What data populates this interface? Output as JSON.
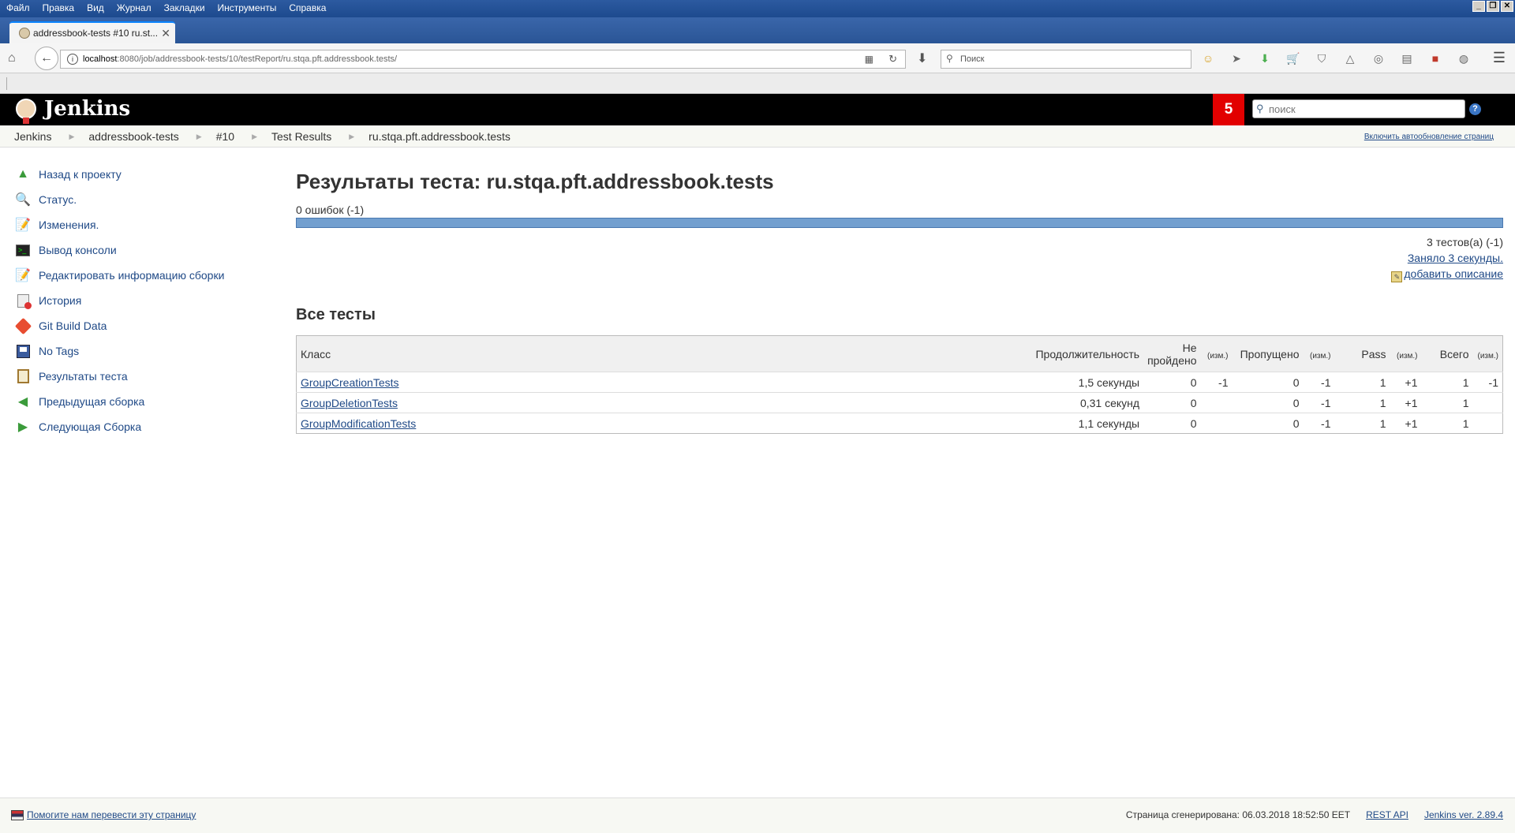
{
  "browser": {
    "menu": [
      "Файл",
      "Правка",
      "Вид",
      "Журнал",
      "Закладки",
      "Инструменты",
      "Справка"
    ],
    "tab_title": "addressbook-tests #10 ru.st...",
    "url_host": "localhost",
    "url_rest": ":8080/job/addressbook-tests/10/testReport/ru.stqa.pft.addressbook.tests/",
    "search_placeholder": "Поиск",
    "window_controls": [
      "_",
      "❐",
      "✕"
    ]
  },
  "header": {
    "title": "Jenkins",
    "badge_count": "5",
    "search_placeholder": "поиск",
    "help": "?"
  },
  "breadcrumb": {
    "items": [
      "Jenkins",
      "addressbook-tests",
      "#10",
      "Test Results",
      "ru.stqa.pft.addressbook.tests"
    ],
    "autorefresh": "Включить автообновление страниц"
  },
  "sidebar": {
    "items": [
      {
        "label": "Назад к проекту",
        "icon": "up-arrow-icon"
      },
      {
        "label": "Статус.",
        "icon": "magnifier-icon"
      },
      {
        "label": "Изменения.",
        "icon": "notepad-icon"
      },
      {
        "label": "Вывод консоли",
        "icon": "terminal-icon"
      },
      {
        "label": "Редактировать информацию сборки",
        "icon": "notepad-icon"
      },
      {
        "label": "История",
        "icon": "history-icon"
      },
      {
        "label": "Git Build Data",
        "icon": "git-icon"
      },
      {
        "label": "No Tags",
        "icon": "save-icon"
      },
      {
        "label": "Результаты теста",
        "icon": "clipboard-icon"
      },
      {
        "label": "Предыдущая сборка",
        "icon": "left-arrow-icon"
      },
      {
        "label": "Следующая Сборка",
        "icon": "right-arrow-icon"
      }
    ]
  },
  "main": {
    "title": "Результаты теста: ru.stqa.pft.addressbook.tests",
    "fail_summary": "0 ошибок (-1)",
    "pass_fraction": 1.0,
    "tests_count": "3 тестов(а) (-1)",
    "duration_link": "Заняло 3 секунды.",
    "add_description": "добавить описание",
    "section_title": "Все тесты",
    "columns": {
      "class": "Класс",
      "duration": "Продолжительность",
      "failed": "Не пройдено",
      "diff": "(изм.)",
      "skipped": "Пропущено",
      "pass": "Pass",
      "total": "Всего"
    },
    "rows": [
      {
        "class": "GroupCreationTests",
        "duration": "1,5 секунды",
        "failed": "0",
        "failed_diff": "-1",
        "skipped": "0",
        "skipped_diff": "-1",
        "pass": "1",
        "pass_diff": "+1",
        "total": "1",
        "total_diff": "-1"
      },
      {
        "class": "GroupDeletionTests",
        "duration": "0,31 секунд",
        "failed": "0",
        "failed_diff": "",
        "skipped": "0",
        "skipped_diff": "-1",
        "pass": "1",
        "pass_diff": "+1",
        "total": "1",
        "total_diff": ""
      },
      {
        "class": "GroupModificationTests",
        "duration": "1,1 секунды",
        "failed": "0",
        "failed_diff": "",
        "skipped": "0",
        "skipped_diff": "-1",
        "pass": "1",
        "pass_diff": "+1",
        "total": "1",
        "total_diff": ""
      }
    ]
  },
  "footer": {
    "translate": "Помогите нам перевести эту страницу",
    "generated": "Страница сгенерирована: 06.03.2018 18:52:50 EET",
    "rest_api": "REST API",
    "version": "Jenkins ver. 2.89.4"
  },
  "colors": {
    "header_bg": "#000000",
    "badge": "#e20000",
    "link": "#204a87",
    "progress_pass": "#729fcf"
  }
}
